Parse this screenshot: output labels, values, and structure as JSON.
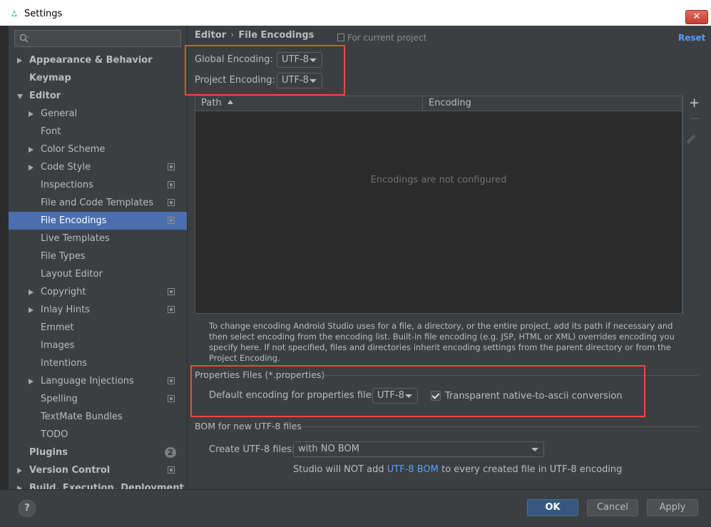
{
  "window": {
    "title": "Settings",
    "close_label": "✕"
  },
  "search": {
    "placeholder": ""
  },
  "sidebar": {
    "items": [
      {
        "label": "Appearance & Behavior",
        "arrow": "right",
        "bold": true,
        "level": 0
      },
      {
        "label": "Keymap",
        "bold": true,
        "level": 0
      },
      {
        "label": "Editor",
        "arrow": "down",
        "bold": true,
        "level": 0
      },
      {
        "label": "General",
        "arrow": "right",
        "level": 1
      },
      {
        "label": "Font",
        "level": 1
      },
      {
        "label": "Color Scheme",
        "arrow": "right",
        "level": 1
      },
      {
        "label": "Code Style",
        "arrow": "right",
        "level": 1,
        "icon": true
      },
      {
        "label": "Inspections",
        "level": 1,
        "icon": true
      },
      {
        "label": "File and Code Templates",
        "level": 1,
        "icon": true
      },
      {
        "label": "File Encodings",
        "level": 1,
        "icon": true,
        "selected": true
      },
      {
        "label": "Live Templates",
        "level": 1
      },
      {
        "label": "File Types",
        "level": 1
      },
      {
        "label": "Layout Editor",
        "level": 1
      },
      {
        "label": "Copyright",
        "arrow": "right",
        "level": 1,
        "icon": true
      },
      {
        "label": "Inlay Hints",
        "arrow": "right",
        "level": 1,
        "icon": true
      },
      {
        "label": "Emmet",
        "level": 1
      },
      {
        "label": "Images",
        "level": 1
      },
      {
        "label": "Intentions",
        "level": 1
      },
      {
        "label": "Language Injections",
        "arrow": "right",
        "level": 1,
        "icon": true
      },
      {
        "label": "Spelling",
        "level": 1,
        "icon": true
      },
      {
        "label": "TextMate Bundles",
        "level": 1
      },
      {
        "label": "TODO",
        "level": 1
      },
      {
        "label": "Plugins",
        "bold": true,
        "level": 0,
        "badge": "2"
      },
      {
        "label": "Version Control",
        "arrow": "right",
        "bold": true,
        "level": 0,
        "icon": true
      },
      {
        "label": "Build, Execution, Deployment",
        "arrow": "right",
        "bold": true,
        "level": 0
      }
    ]
  },
  "breadcrumb": {
    "parent": "Editor",
    "separator": "›",
    "current": "File Encodings"
  },
  "for_project": "For current project",
  "reset_label": "Reset",
  "global_encoding": {
    "label": "Global Encoding:",
    "value": "UTF-8"
  },
  "project_encoding": {
    "label": "Project Encoding:",
    "value": "UTF-8"
  },
  "table": {
    "columns": [
      "Path",
      "Encoding"
    ],
    "empty_text": "Encodings are not configured",
    "add_label": "+",
    "remove_label": "−"
  },
  "help_text": "To change encoding Android Studio uses for a file, a directory, or the entire project, add its path if necessary and then select encoding from the encoding list. Built-in file encoding (e.g. JSP, HTML or XML) overrides encoding you specify here. If not specified, files and directories inherit encoding settings from the parent directory or from the Project Encoding.",
  "properties": {
    "title": "Properties Files (*.properties)",
    "default_label": "Default encoding for properties files:",
    "default_value": "UTF-8",
    "transparent_label": "Transparent native-to-ascii conversion",
    "transparent_checked": true
  },
  "bom": {
    "title": "BOM for new UTF-8 files",
    "create_label": "Create UTF-8 files:",
    "create_value": "with NO BOM",
    "note_prefix": "Studio will NOT add",
    "note_link": "UTF-8 BOM",
    "note_suffix": "to every created file in UTF-8 encoding"
  },
  "footer": {
    "help": "?",
    "ok": "OK",
    "cancel": "Cancel",
    "apply": "Apply"
  },
  "colors": {
    "accent": "#4b6eaf",
    "highlight": "#e74c3c",
    "link": "#589df6",
    "primary_button": "#365880"
  }
}
